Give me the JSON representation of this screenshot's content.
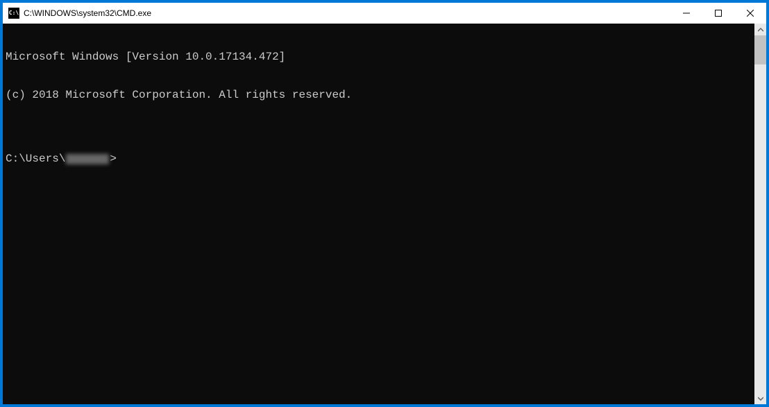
{
  "titlebar": {
    "icon_label": "C:\\",
    "title": "C:\\WINDOWS\\system32\\CMD.exe"
  },
  "terminal": {
    "line1": "Microsoft Windows [Version 10.0.17134.472]",
    "line2": "(c) 2018 Microsoft Corporation. All rights reserved.",
    "blank": "",
    "prompt_prefix": "C:\\Users\\",
    "prompt_suffix": ">"
  }
}
